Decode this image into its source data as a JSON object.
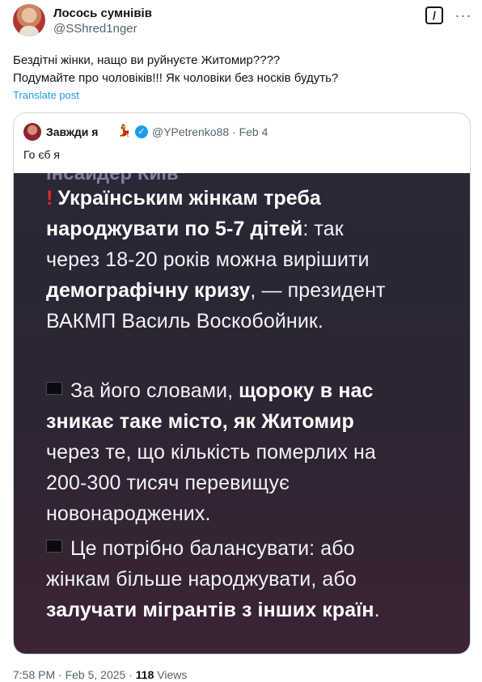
{
  "tweet": {
    "display_name": "Лосось сумнівів",
    "handle": "@SShred1nger",
    "text_lines": [
      "Бездітні жінки, нащо ви руйнуєте Житомир????",
      "Подумайте про чоловіків!!! Як чоловіки без носків будуть?"
    ],
    "translate_label": "Translate post",
    "grok_icon": "grok-icon",
    "more_icon": "more-icon",
    "time": "7:58 PM",
    "separator": "·",
    "date": "Feb 5, 2025",
    "views_count": "118",
    "views_label": "Views"
  },
  "quote": {
    "display_name": "Завжди я",
    "emoji": "💃",
    "handle": "@YPetrenko88",
    "date": "· Feb 4",
    "text": "Го єб   я",
    "media": {
      "clipped_header": "Інсайдер Київ",
      "p1": [
        "Українським жінкам треба",
        "народжувати по 5-7 дітей",
        ": так",
        "через 18-20 років можна вирішити",
        "демографічну кризу",
        ", — президент",
        "ВАКМП Василь Воскобойник."
      ],
      "p2": [
        "За його словами, ",
        "щороку в нас",
        "зникає таке місто, як Житомир",
        "через те, що кількість померлих на",
        "200-300 тисяч перевищує",
        "новонароджених."
      ],
      "p3": [
        "Це потрібно балансувати: або",
        "жінкам більше народжувати, або",
        "залучати мігрантів з інших країн",
        "."
      ]
    }
  },
  "colors": {
    "link": "#1d9bf0",
    "secondary_text": "#536471",
    "media_background": "#2c2534"
  }
}
